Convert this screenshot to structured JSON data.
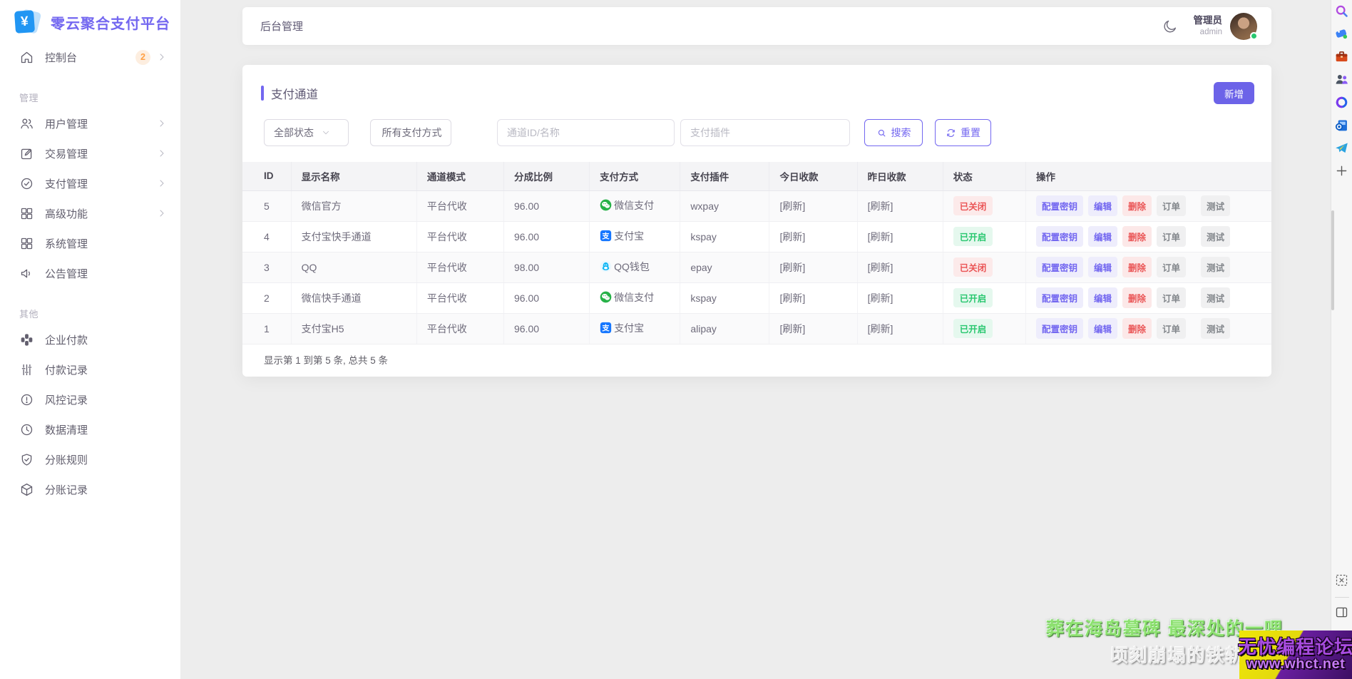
{
  "app": {
    "brand": "零云聚合支付平台",
    "brand_symbol": "¥",
    "colors": {
      "primary": "#7367f0",
      "success": "#28c76f",
      "danger": "#ea5455",
      "warning": "#ff9f43",
      "logo_blue": "#2196f3"
    }
  },
  "topbar": {
    "title": "后台管理",
    "user_role": "管理员",
    "user_name": "admin"
  },
  "sidebar": {
    "console": {
      "label": "控制台",
      "badge": "2",
      "icon": "home"
    },
    "groups": [
      {
        "label": "管理",
        "items": [
          {
            "key": "users",
            "label": "用户管理",
            "icon": "users",
            "chevron": true
          },
          {
            "key": "trades",
            "label": "交易管理",
            "icon": "edit",
            "chevron": true
          },
          {
            "key": "payments",
            "label": "支付管理",
            "icon": "check-circle",
            "chevron": true
          },
          {
            "key": "advanced",
            "label": "高级功能",
            "icon": "grid",
            "chevron": true
          },
          {
            "key": "system",
            "label": "系统管理",
            "icon": "grid",
            "chevron": false
          },
          {
            "key": "announcements",
            "label": "公告管理",
            "icon": "speaker",
            "chevron": false
          }
        ]
      },
      {
        "label": "其他",
        "items": [
          {
            "key": "enterprise-pay",
            "label": "企业付款",
            "icon": "blocks",
            "chevron": false
          },
          {
            "key": "pay-records",
            "label": "付款记录",
            "icon": "sliders",
            "chevron": false
          },
          {
            "key": "risk-records",
            "label": "风控记录",
            "icon": "alert",
            "chevron": false
          },
          {
            "key": "data-clean",
            "label": "数据清理",
            "icon": "clock",
            "chevron": false
          },
          {
            "key": "split-rules",
            "label": "分账规则",
            "icon": "shield",
            "chevron": false
          },
          {
            "key": "split-records",
            "label": "分账记录",
            "icon": "box",
            "chevron": false
          }
        ]
      }
    ]
  },
  "page": {
    "card_title": "支付通道",
    "add_button": "新增",
    "filters": {
      "status_select": "全部状态",
      "method_select": "所有支付方式",
      "channel_placeholder": "通道ID/名称",
      "plugin_placeholder": "支付插件",
      "search_button": "搜索",
      "reset_button": "重置"
    },
    "table": {
      "columns": [
        "ID",
        "显示名称",
        "通道模式",
        "分成比例",
        "支付方式",
        "支付插件",
        "今日收款",
        "昨日收款",
        "状态",
        "操作"
      ],
      "status_on": "已开启",
      "status_off": "已关闭",
      "actions": [
        "配置密钥",
        "编辑",
        "删除",
        "订单",
        "测试"
      ],
      "rows": [
        {
          "id": "5",
          "name": "微信官方",
          "mode": "平台代收",
          "ratio": "96.00",
          "method": "微信支付",
          "method_icon": "wechat",
          "plugin": "wxpay",
          "today": "[刷新]",
          "yesterday": "[刷新]",
          "status": "off"
        },
        {
          "id": "4",
          "name": "支付宝快手通道",
          "mode": "平台代收",
          "ratio": "96.00",
          "method": "支付宝",
          "method_icon": "alipay",
          "plugin": "kspay",
          "today": "[刷新]",
          "yesterday": "[刷新]",
          "status": "on"
        },
        {
          "id": "3",
          "name": "QQ",
          "mode": "平台代收",
          "ratio": "98.00",
          "method": "QQ钱包",
          "method_icon": "qq",
          "plugin": "epay",
          "today": "[刷新]",
          "yesterday": "[刷新]",
          "status": "off"
        },
        {
          "id": "2",
          "name": "微信快手通道",
          "mode": "平台代收",
          "ratio": "96.00",
          "method": "微信支付",
          "method_icon": "wechat",
          "plugin": "kspay",
          "today": "[刷新]",
          "yesterday": "[刷新]",
          "status": "on"
        },
        {
          "id": "1",
          "name": "支付宝H5",
          "mode": "平台代收",
          "ratio": "96.00",
          "method": "支付宝",
          "method_icon": "alipay",
          "plugin": "alipay",
          "today": "[刷新]",
          "yesterday": "[刷新]",
          "status": "on"
        }
      ]
    },
    "footer": "显示第 1 到第 5 条, 总共 5 条"
  },
  "edge_strip": {
    "top_icons": [
      "browser-search",
      "tag",
      "briefcase",
      "contacts",
      "sync-loop",
      "mail",
      "telegram",
      "add-plus"
    ],
    "bottom_icons": [
      "screenshot",
      "split-view"
    ]
  },
  "watermark": {
    "line1": "葬在海岛墓碑 最深处的一哩",
    "line2": "顷刻崩塌的铁轨",
    "forum_name": "无忧编程论坛",
    "forum_url": "www.whct.net"
  }
}
